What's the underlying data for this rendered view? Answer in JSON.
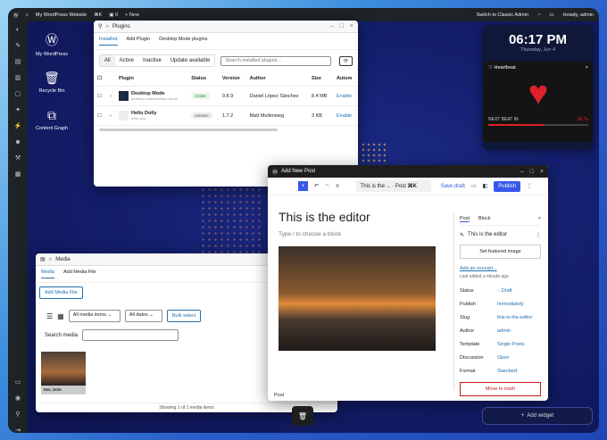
{
  "adminbar": {
    "site": "My WordPress Website",
    "shortcut": "⌘K",
    "comments": "0",
    "new": "New",
    "classic": "Switch to Classic Admin",
    "howdy": "Howdy, admin"
  },
  "desktop": {
    "icons": [
      {
        "label": "My WordPress",
        "icon": "wordpress-icon"
      },
      {
        "label": "Recycle Bin",
        "icon": "trash-icon"
      },
      {
        "label": "Content Graph",
        "icon": "graph-icon"
      }
    ]
  },
  "clock": {
    "time": "06:17 PM",
    "date": "Thursday, Jun 4"
  },
  "heartbeat": {
    "title": "Heartbeat",
    "next_label": "NEXT BEAT IN",
    "next_value": "26.7s",
    "progress": 0.55
  },
  "plugins": {
    "title": "Plugins",
    "tabs": [
      "Installed",
      "Add Plugin",
      "Desktop Mode plugins"
    ],
    "filters": [
      "All",
      "Active",
      "Inactive",
      "Update available"
    ],
    "search_placeholder": "Search installed plugins...",
    "headers": [
      "Plugin",
      "Status",
      "Version",
      "Author",
      "Size",
      "Autom"
    ],
    "rows": [
      {
        "name": "Desktop Mode",
        "path": "desktop-mode/desktop-mode",
        "status": "Active",
        "version": "0.8.9",
        "author": "Daniel López Sánchez",
        "size": "8.4 MB",
        "auto": "Enable"
      },
      {
        "name": "Hello Dolly",
        "path": "hello.php",
        "status": "Inactive",
        "version": "1.7.2",
        "author": "Matt Mullenweg",
        "size": "3 KB",
        "auto": "Enable"
      }
    ]
  },
  "media": {
    "title": "Media",
    "tabs": [
      "Media",
      "Add Media File"
    ],
    "add_button": "Add Media File",
    "type_select": "All media items",
    "date_select": "All dates",
    "bulk": "Bulk select",
    "search_label": "Search media",
    "item_caption": "two_bots",
    "footer": "Showing 1 of 1 media items"
  },
  "editor": {
    "title": "Add New Post",
    "doc_title": "This is the ... · Post",
    "shortcut": "⌘K",
    "save_draft": "Save draft",
    "publish": "Publish",
    "heading": "This is the editor",
    "placeholder": "Type / to choose a block",
    "footer_label": "Post",
    "panel": {
      "tabs": [
        "Post",
        "Block"
      ],
      "post_title": "This is the editor",
      "featured": "Set featured image",
      "excerpt": "Add an excerpt...",
      "edited": "Last edited a minute ago.",
      "meta": [
        {
          "k": "Status",
          "v": "Draft"
        },
        {
          "k": "Publish",
          "v": "Immediately"
        },
        {
          "k": "Slug",
          "v": "this-is-the-editor"
        },
        {
          "k": "Author",
          "v": "admin"
        },
        {
          "k": "Template",
          "v": "Single Posts"
        },
        {
          "k": "Discussion",
          "v": "Open"
        },
        {
          "k": "Format",
          "v": "Standard"
        }
      ],
      "trash": "Move to trash"
    }
  },
  "widget": {
    "label": "Add widget"
  }
}
